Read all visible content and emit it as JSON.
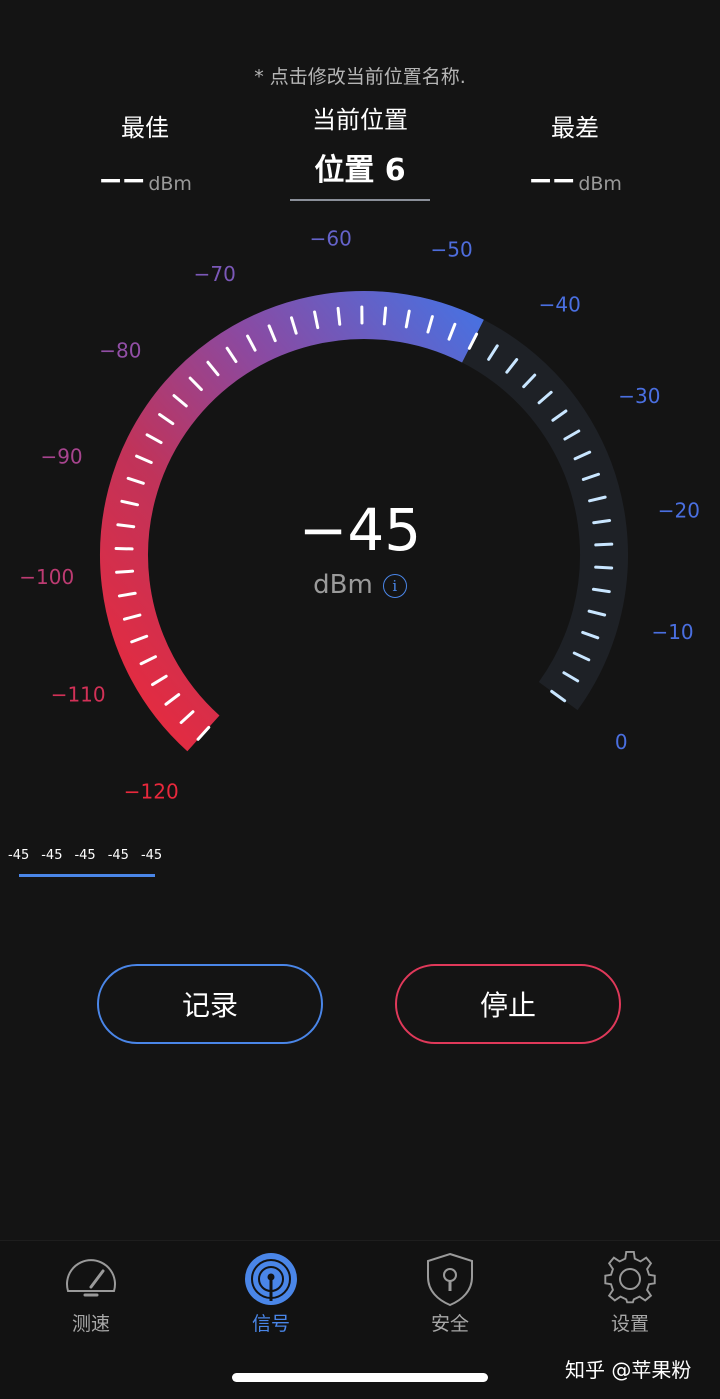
{
  "hint": "* 点击修改当前位置名称.",
  "best": {
    "label": "最佳",
    "value": "−−",
    "unit": "dBm"
  },
  "current": {
    "label": "当前位置",
    "location": "位置 6"
  },
  "worst": {
    "label": "最差",
    "value": "−−",
    "unit": "dBm"
  },
  "gauge": {
    "scale_labels": [
      "−120",
      "−110",
      "−100",
      "−90",
      "−80",
      "−70",
      "−60",
      "−50",
      "−40",
      "−30",
      "−20",
      "−10",
      "0"
    ],
    "scale_values": [
      -120,
      -110,
      -100,
      -90,
      -80,
      -70,
      -60,
      -50,
      -40,
      -30,
      -20,
      -10,
      0
    ],
    "min": -120,
    "max": 0,
    "current_value": -45,
    "colors": {
      "low": "#e8283c",
      "mid": "#9a4a9e",
      "high": "#4a6fe0",
      "track": "#1e2126",
      "tick": "#ffffff",
      "tick_dim": "#c9e6ff"
    }
  },
  "reading": {
    "value": "−45",
    "unit": "dBm",
    "info_icon": "i"
  },
  "history": {
    "values": [
      "-45",
      "-45",
      "-45",
      "-45",
      "-45"
    ]
  },
  "buttons": {
    "record": "记录",
    "stop": "停止"
  },
  "tabs": [
    {
      "label": "测速",
      "icon": "speedometer-icon",
      "active": false
    },
    {
      "label": "信号",
      "icon": "signal-icon",
      "active": true
    },
    {
      "label": "安全",
      "icon": "shield-lock-icon",
      "active": false
    },
    {
      "label": "设置",
      "icon": "gear-icon",
      "active": false
    }
  ],
  "watermark": "知乎 @苹果粉",
  "colors": {
    "accent": "#4a86e8",
    "danger": "#e0395a",
    "background": "#141414"
  }
}
